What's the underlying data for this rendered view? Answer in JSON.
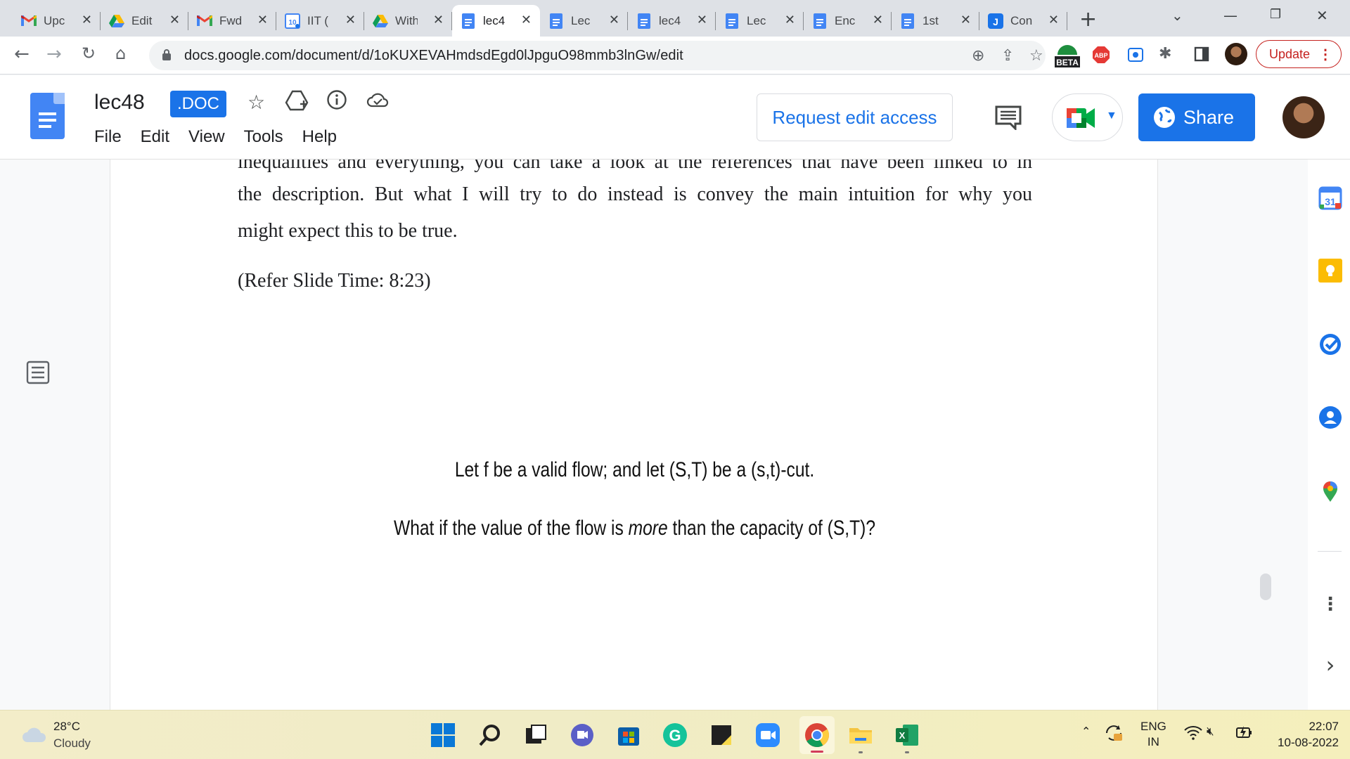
{
  "browser": {
    "tabs": [
      {
        "title": "Upc",
        "icon": "gmail-icon",
        "active": false
      },
      {
        "title": "Edit",
        "icon": "google-drive-icon",
        "active": false
      },
      {
        "title": "Fwd",
        "icon": "gmail-icon",
        "active": false
      },
      {
        "title": "IIT (",
        "icon": "calendar-10-icon",
        "active": false
      },
      {
        "title": "With",
        "icon": "google-drive-icon",
        "active": false
      },
      {
        "title": "lec4",
        "icon": "docs-icon",
        "active": true
      },
      {
        "title": "Lec",
        "icon": "docs-icon",
        "active": false
      },
      {
        "title": "lec4",
        "icon": "docs-icon",
        "active": false
      },
      {
        "title": "Lec",
        "icon": "docs-icon",
        "active": false
      },
      {
        "title": "Enc",
        "icon": "docs-icon",
        "active": false
      },
      {
        "title": "1st",
        "icon": "docs-icon",
        "active": false
      },
      {
        "title": "Con",
        "icon": "j-app-icon",
        "active": false
      }
    ],
    "close_glyph": "✕",
    "new_tab_glyph": "+",
    "url": "docs.google.com/document/d/1oKUXEVAHmdsdEgd0lJpguO98mmb3lnGw/edit",
    "beta_label": "BETA",
    "abp_label": "ABP",
    "update_label": "Update"
  },
  "docs": {
    "title": "lec48",
    "badge": ".DOC",
    "menu": [
      "File",
      "Edit",
      "View",
      "Tools",
      "Help"
    ],
    "request_edit_label": "Request edit access",
    "share_label": "Share",
    "accent_color": "#1a73e8"
  },
  "document": {
    "line_cut": "inequalities and everything, you can take a look at the references that have been linked to in",
    "line1": "the description. But what I will try to do instead is convey the main intuition for why you",
    "line2": "might expect this to be true.",
    "slide_time": "(Refer Slide Time: 8:23)",
    "slide_line1": "Let f be a valid flow; and let (S,T) be a (s,t)-cut.",
    "slide_line2_pre": "What if the value of the flow is ",
    "slide_line2_em": "more",
    "slide_line2_post": " than the capacity of (S,T)?"
  },
  "side_panel": {
    "calendar_day": "31",
    "more_glyph": "⋮",
    "expand_glyph": "›"
  },
  "taskbar": {
    "temperature": "28°C",
    "condition": "Cloudy",
    "lang_line1": "ENG",
    "lang_line2": "IN",
    "time": "22:07",
    "date": "10-08-2022"
  }
}
